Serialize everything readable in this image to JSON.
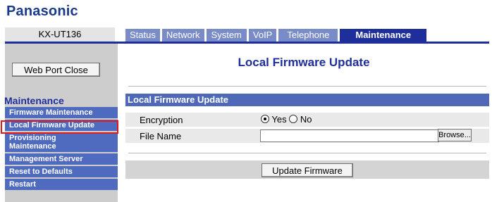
{
  "brand": {
    "logo": "Panasonic"
  },
  "model": "KX-UT136",
  "tabs": [
    {
      "label": "Status"
    },
    {
      "label": "Network"
    },
    {
      "label": "System"
    },
    {
      "label": "VoIP"
    },
    {
      "label": "Telephone"
    },
    {
      "label": "Maintenance"
    }
  ],
  "active_tab": "Maintenance",
  "sidebar": {
    "web_port_close": "Web Port Close",
    "heading": "Maintenance",
    "items": [
      {
        "label": "Firmware Maintenance"
      },
      {
        "label": "Local Firmware Update"
      },
      {
        "label": "Provisioning\nMaintenance"
      },
      {
        "label": "Management Server"
      },
      {
        "label": "Reset to Defaults"
      },
      {
        "label": "Restart"
      }
    ],
    "selected": "Local Firmware Update"
  },
  "main": {
    "title": "Local Firmware Update",
    "section_header": "Local Firmware Update",
    "encryption_label": "Encryption",
    "encryption_yes": "Yes",
    "encryption_no": "No",
    "encryption_value": "Yes",
    "file_name_label": "File Name",
    "file_name_value": "",
    "browse_label": "Browse...",
    "update_button": "Update Firmware"
  },
  "colors": {
    "brand_blue": "#1e2f9b",
    "tab_inactive": "#7a8cc7",
    "menu_blue": "#4f6bbf",
    "highlight_red": "#e01b1b"
  }
}
